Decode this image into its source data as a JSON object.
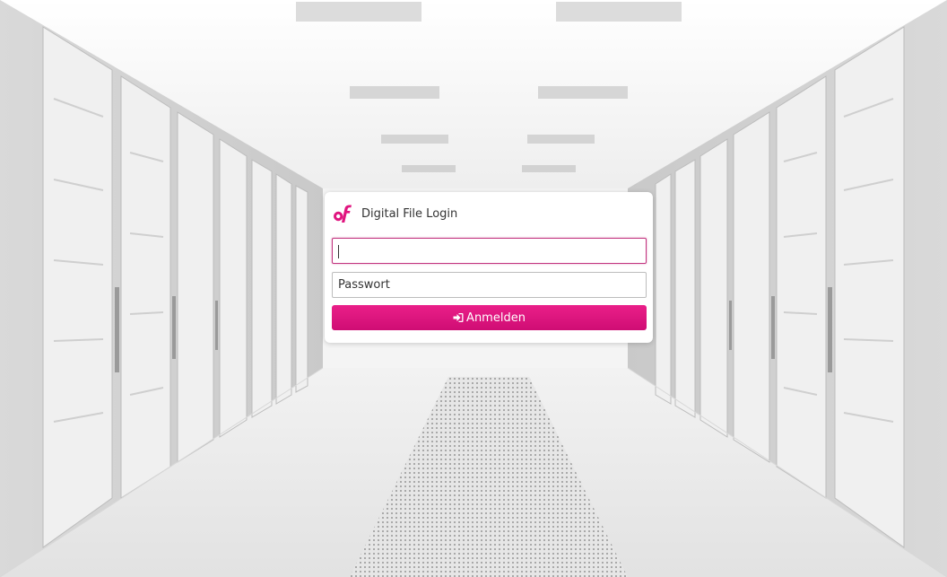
{
  "login": {
    "title": "Digital File Login",
    "username_value": "",
    "username_placeholder": "",
    "password_placeholder": "Passwort",
    "submit_label": "Anmelden"
  },
  "icons": {
    "logo": "digital-file-logo",
    "submit": "sign-in-icon"
  },
  "colors": {
    "accent": "#e0157f",
    "focus_border": "#c2347f"
  }
}
